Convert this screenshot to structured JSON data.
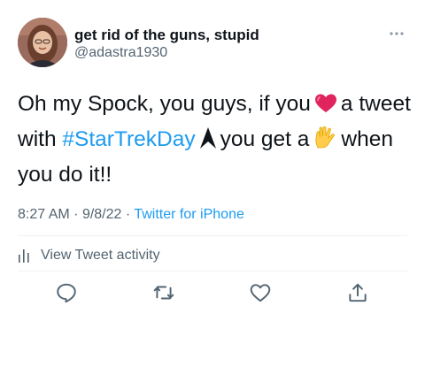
{
  "author": {
    "display_name": "get rid of the guns, stupid",
    "handle": "@adastra1930",
    "avatar_icon": "profile-photo"
  },
  "tweet": {
    "text_part1": "Oh my Spock, you guys, if you",
    "heart_icon": "red-heart-emoji",
    "text_part2": "a tweet with",
    "hashtag": "#StarTrekDay",
    "starfleet_icon": "starfleet-delta-emoji",
    "text_part3": "you get a",
    "vulcan_icon": "vulcan-salute-emoji",
    "text_part4": "when you do it!!"
  },
  "meta": {
    "time": "8:27 AM",
    "sep1": "·",
    "date": "9/8/22",
    "sep2": "·",
    "source": "Twitter for iPhone"
  },
  "activity": {
    "label": "View Tweet activity"
  },
  "colors": {
    "link": "#1d9bf0",
    "text": "#0f1419",
    "secondary": "#536471",
    "heart": "#e0245e"
  },
  "actions": [
    "reply-icon",
    "retweet-icon",
    "like-icon",
    "share-icon"
  ]
}
